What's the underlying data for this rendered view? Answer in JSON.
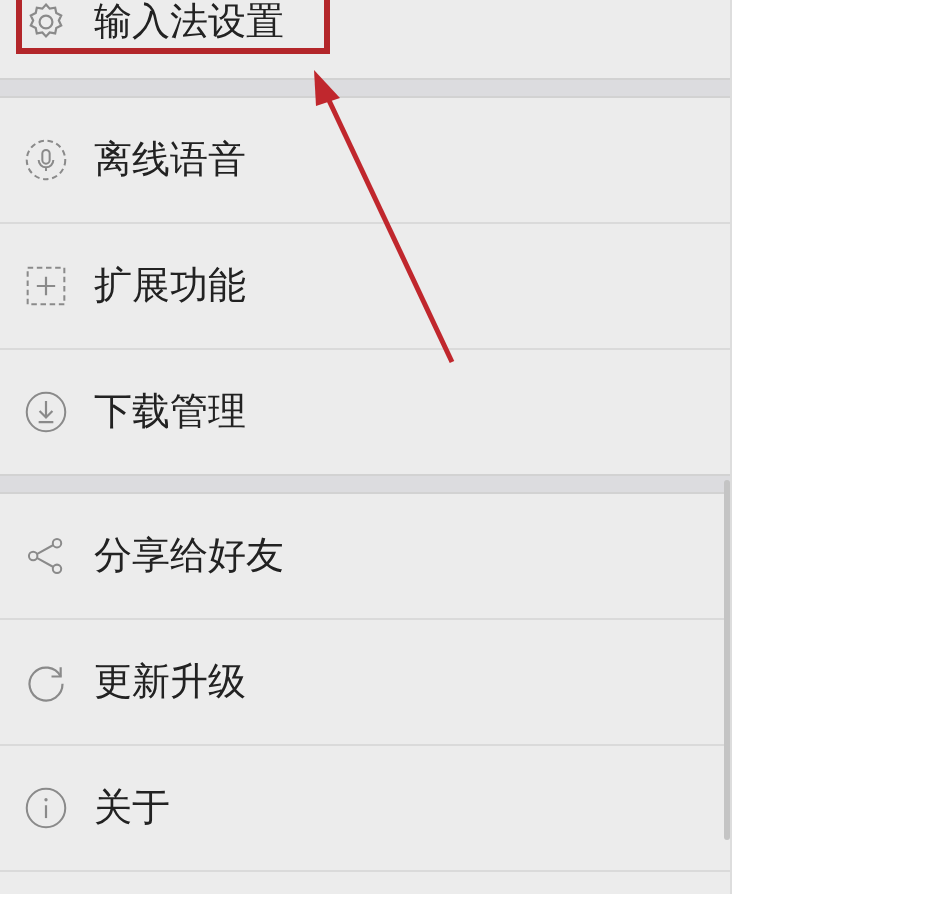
{
  "groups": [
    {
      "items": [
        {
          "label": "输入法设置",
          "kind": "gear",
          "highlighted": true
        }
      ]
    },
    {
      "items": [
        {
          "label": "离线语音",
          "kind": "mic",
          "highlighted": false
        },
        {
          "label": "扩展功能",
          "kind": "plus",
          "highlighted": false
        },
        {
          "label": "下载管理",
          "kind": "download",
          "highlighted": false
        }
      ]
    },
    {
      "items": [
        {
          "label": "分享给好友",
          "kind": "share",
          "highlighted": false
        },
        {
          "label": "更新升级",
          "kind": "refresh",
          "highlighted": false
        },
        {
          "label": "关于",
          "kind": "info",
          "highlighted": false
        }
      ]
    }
  ]
}
